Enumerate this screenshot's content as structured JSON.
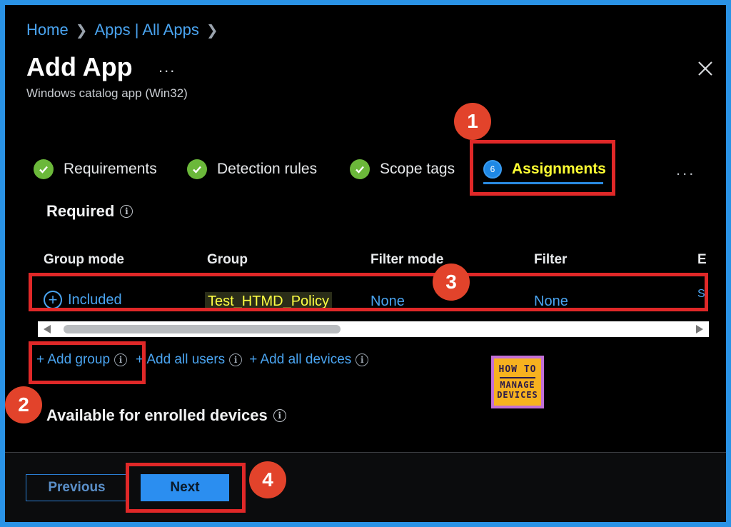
{
  "breadcrumb": {
    "home": "Home",
    "apps": "Apps | All Apps"
  },
  "header": {
    "title": "Add App",
    "more": "...",
    "subtitle": "Windows catalog app (Win32)"
  },
  "steps": [
    {
      "label": "Requirements",
      "status": "complete"
    },
    {
      "label": "Detection rules",
      "status": "complete"
    },
    {
      "label": "Scope tags",
      "status": "complete"
    },
    {
      "number": "6",
      "label": "Assignments",
      "status": "active"
    }
  ],
  "steps_more": "...",
  "required": {
    "title": "Required"
  },
  "table": {
    "headers": [
      "Group mode",
      "Group",
      "Filter mode",
      "Filter",
      "E"
    ],
    "rows": [
      {
        "group_mode": "Included",
        "group": "Test_HTMD_Policy",
        "filter_mode": "None",
        "filter": "None",
        "extra": "S"
      }
    ]
  },
  "links": {
    "add_group": "+ Add group",
    "add_all_users": "+ Add all users",
    "add_all_devices": "+ Add all devices",
    "add_all_users_prefix": "·"
  },
  "available": {
    "title": "Available for enrolled devices"
  },
  "logo": {
    "line1": "HOW TO",
    "line2": "MANAGE",
    "line3": "DEVICES"
  },
  "footer": {
    "previous": "Previous",
    "next": "Next"
  },
  "callouts": [
    "1",
    "2",
    "3",
    "4"
  ],
  "colors": {
    "accent": "#2b8ef0",
    "link": "#4aa4f0",
    "highlight": "#e02828",
    "check": "#6bb83a"
  }
}
